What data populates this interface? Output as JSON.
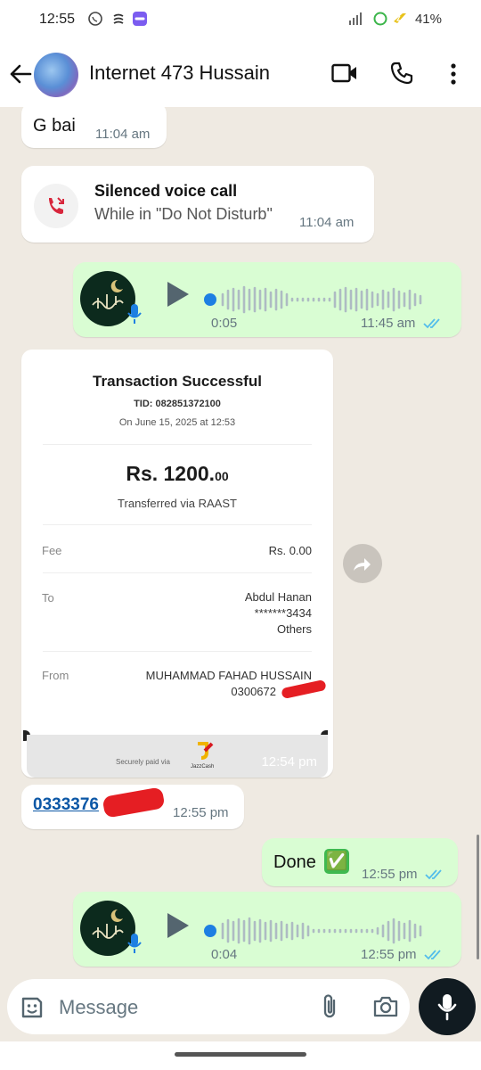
{
  "status_bar": {
    "time": "12:55",
    "battery": "41%"
  },
  "header": {
    "contact_name": "Internet 473 Hussain"
  },
  "messages": {
    "g_bai": {
      "text": "G bai",
      "time": "11:04 am"
    },
    "call": {
      "title": "Silenced voice call",
      "subtitle": "While in \"Do Not Disturb\"",
      "time": "11:04 am"
    },
    "voice1": {
      "duration": "0:05",
      "time": "11:45 am"
    },
    "receipt": {
      "title": "Transaction Successful",
      "tid": "TID: 082851372100",
      "date": "On June 15, 2025 at 12:53",
      "amount_main": "Rs. 1200.",
      "amount_cents": "00",
      "via": "Transferred via RAAST",
      "fee_label": "Fee",
      "fee_value": "Rs. 0.00",
      "to_label": "To",
      "to_name": "Abdul Hanan",
      "to_account": "*******3434",
      "to_bank": "Others",
      "from_label": "From",
      "from_name": "MUHAMMAD FAHAD HUSSAIN",
      "from_account": "0300672",
      "secure_text": "Securely paid via",
      "brand": "JazzCash",
      "time": "12:54 pm"
    },
    "number": {
      "text": "0333376",
      "time": "12:55 pm"
    },
    "done": {
      "text": "Done",
      "emoji": "✅",
      "time": "12:55 pm"
    },
    "voice2": {
      "duration": "0:04",
      "time": "12:55 pm"
    }
  },
  "composer": {
    "placeholder": "Message"
  },
  "colors": {
    "outgoing": "#d9fdd3",
    "incoming": "#ffffff",
    "read_tick": "#53bdeb",
    "voice_dot": "#1d7fe2"
  }
}
